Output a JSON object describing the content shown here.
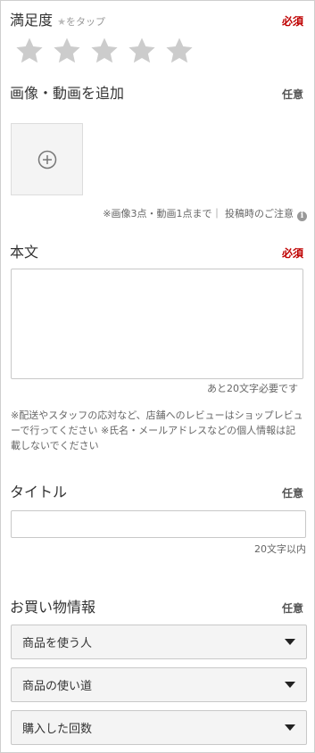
{
  "rating": {
    "title": "満足度",
    "hint_star": "★",
    "hint_text": "をタップ",
    "required_label": "必須",
    "star_count": 5,
    "star_color": "#cccccc"
  },
  "media": {
    "title": "画像・動画を追加",
    "optional_label": "任意",
    "add_icon": "plus-circle-icon",
    "note": "※画像3点・動画1点まで｜",
    "caution_link": "投稿時のご注意",
    "info_icon": "i"
  },
  "body": {
    "title": "本文",
    "required_label": "必須",
    "value": "",
    "counter": "あと20文字必要です",
    "caution": "※配送やスタッフの応対など、店舗へのレビューはショップレビューで行ってください ※氏名・メールアドレスなどの個人情報は記載しないでください"
  },
  "title_field": {
    "title": "タイトル",
    "optional_label": "任意",
    "value": "",
    "counter": "20文字以内"
  },
  "purchase": {
    "title": "お買い物情報",
    "optional_label": "任意",
    "selects": [
      {
        "label": "商品を使う人"
      },
      {
        "label": "商品の使い道"
      },
      {
        "label": "購入した回数"
      }
    ]
  },
  "colors": {
    "required": "#bf0000",
    "border": "#c8c8c8",
    "select_bg": "#f4f4f4"
  }
}
